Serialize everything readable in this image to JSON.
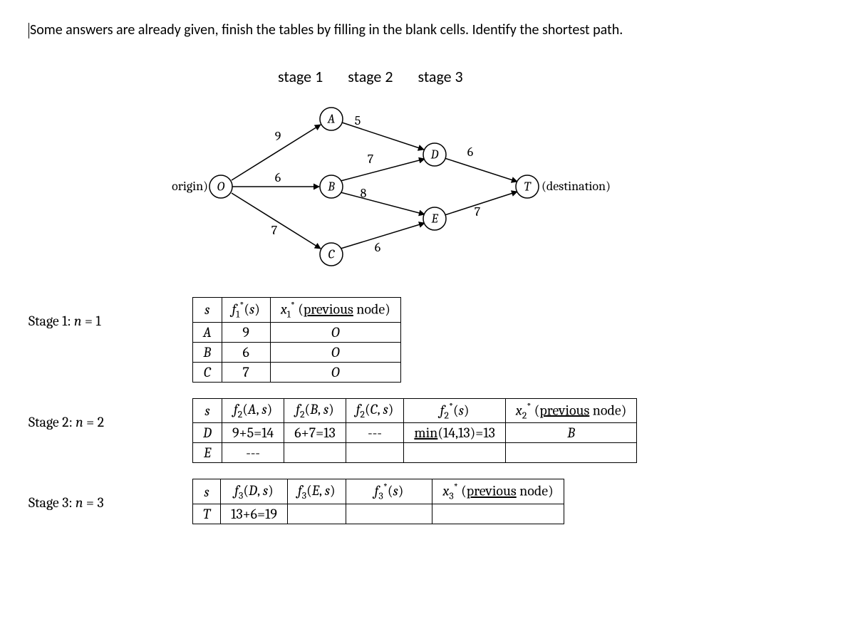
{
  "prompt": "Some answers are already given, finish the tables by filling in the blank cells. Identify the shortest path.",
  "stage_labels": {
    "s1": "stage 1",
    "s2": "stage 2",
    "s3": "stage 3"
  },
  "graph": {
    "origin_label": "(origin)",
    "dest_label": "(destination)",
    "nodes": {
      "O": "O",
      "A": "A",
      "B": "B",
      "C": "C",
      "D": "D",
      "E": "E",
      "T": "T"
    },
    "edges": {
      "OA": "9",
      "OB": "6",
      "OC": "7",
      "AD": "5",
      "BD": "7",
      "BE": "8",
      "CE": "6",
      "DT": "6",
      "ET": "7"
    }
  },
  "stage1": {
    "label": "Stage 1: n = 1",
    "hdr": {
      "s": "s",
      "f": "f₁*(s)",
      "x": "x₁* (previous node)",
      "x_word": "previous"
    },
    "rows": [
      {
        "s": "A",
        "f": "9",
        "x": "O"
      },
      {
        "s": "B",
        "f": "6",
        "x": "O"
      },
      {
        "s": "C",
        "f": "7",
        "x": "O"
      }
    ]
  },
  "stage2": {
    "label": "Stage 2: n = 2",
    "hdr": {
      "s": "s",
      "fA": "f₂(A, s)",
      "fB": "f₂(B, s)",
      "fC": "f₂(C, s)",
      "fstar": "f₂*(s)",
      "x": "x₂* (previous node)",
      "x_word": "previous"
    },
    "rows": [
      {
        "s": "D",
        "fA": "9+5=14",
        "fB": "6+7=13",
        "fC": "---",
        "fstar": "min(14,13)=13",
        "x": "B"
      },
      {
        "s": "E",
        "fA": "---",
        "fB": "",
        "fC": "",
        "fstar": "",
        "x": ""
      }
    ]
  },
  "stage3": {
    "label": "Stage 3: n = 3",
    "hdr": {
      "s": "s",
      "fD": "f₃(D, s)",
      "fE": "f₃(E, s)",
      "fstar": "f₃*(s)",
      "x": "x₃* (previous node)",
      "x_word": "previous"
    },
    "rows": [
      {
        "s": "T",
        "fD": "13+6=19",
        "fE": "",
        "fstar": "",
        "x": ""
      }
    ]
  }
}
